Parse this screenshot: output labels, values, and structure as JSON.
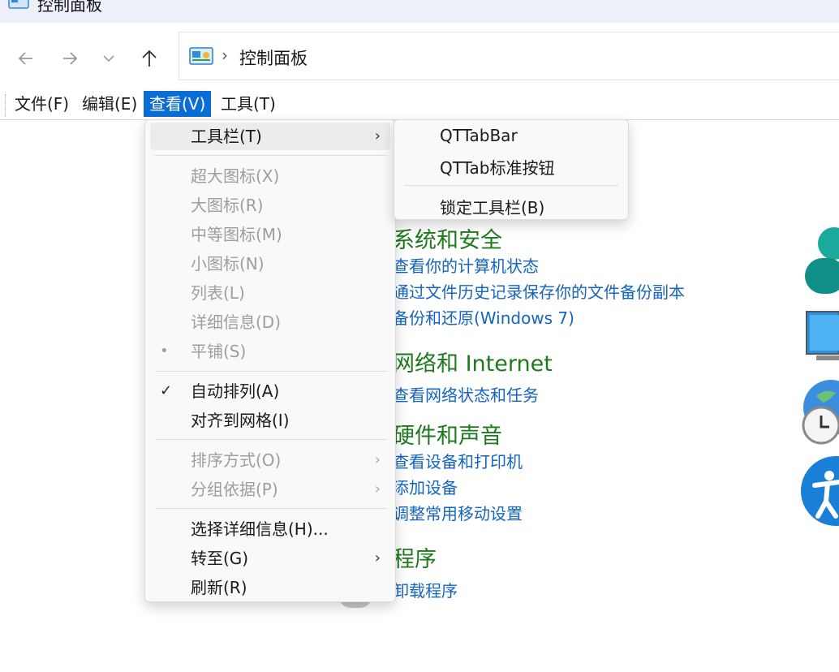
{
  "window": {
    "title": "控制面板"
  },
  "nav": {
    "back": "back-arrow-icon",
    "forward": "forward-arrow-icon",
    "recent": "chevron-down-icon",
    "up": "up-arrow-icon",
    "breadcrumb_sep": "›",
    "breadcrumb": "控制面板"
  },
  "menubar": {
    "file": "文件(F)",
    "edit": "编辑(E)",
    "view": "查看(V)",
    "tools": "工具(T)"
  },
  "view_menu": {
    "toolbar": "工具栏(T)",
    "extra_large_icons": "超大图标(X)",
    "large_icons": "大图标(R)",
    "medium_icons": "中等图标(M)",
    "small_icons": "小图标(N)",
    "list": "列表(L)",
    "details": "详细信息(D)",
    "tiles": "平铺(S)",
    "auto_arrange": "自动排列(A)",
    "align_to_grid": "对齐到网格(I)",
    "sort_by": "排序方式(O)",
    "group_by": "分组依据(P)",
    "choose_details": "选择详细信息(H)...",
    "go_to": "转至(G)",
    "refresh": "刷新(R)",
    "submenu_arrow": "›",
    "check": "✓",
    "bullet": "•"
  },
  "toolbar_submenu": {
    "qttabbar": "QTTabBar",
    "qttab_std_buttons": "QTTab标准按钮",
    "lock_toolbars": "锁定工具栏(B)"
  },
  "content": {
    "system_security": {
      "title": "系统和安全",
      "links": [
        "查看你的计算机状态",
        "通过文件历史记录保存你的文件备份副本",
        "备份和还原(Windows 7)"
      ]
    },
    "network": {
      "title": "网络和 Internet",
      "links": [
        "查看网络状态和任务"
      ]
    },
    "hardware": {
      "title": "硬件和声音",
      "links": [
        "查看设备和打印机",
        "添加设备",
        "调整常用移动设置"
      ]
    },
    "programs": {
      "title": "程序",
      "links": [
        "卸载程序"
      ]
    }
  },
  "colors": {
    "accent": "#0a6dd6",
    "category_title": "#1e7a1e",
    "link": "#1565c0",
    "disabled": "#9e9e9e"
  }
}
